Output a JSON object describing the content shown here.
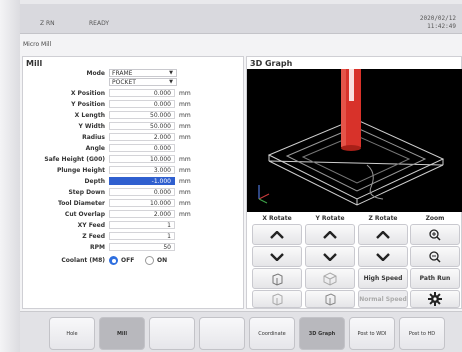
{
  "status": {
    "axis": "Z RN",
    "state": "READY",
    "date": "2020/02/12",
    "time": "11:42:49"
  },
  "breadcrumb": "Micro Mill",
  "mill": {
    "title": "Mill",
    "mode_label": "Mode",
    "mode_options": [
      "FRAME",
      "POCKET"
    ],
    "params": [
      {
        "label": "X Position",
        "value": "0.000",
        "unit": "mm"
      },
      {
        "label": "Y Position",
        "value": "0.000",
        "unit": "mm"
      },
      {
        "label": "X Length",
        "value": "50.000",
        "unit": "mm"
      },
      {
        "label": "Y Width",
        "value": "50.000",
        "unit": "mm"
      },
      {
        "label": "Radius",
        "value": "2.000",
        "unit": "mm"
      },
      {
        "label": "Angle",
        "value": "0.000",
        "unit": ""
      },
      {
        "label": "Safe Height (G00)",
        "value": "10.000",
        "unit": "mm"
      },
      {
        "label": "Plunge Height",
        "value": "3.000",
        "unit": "mm"
      },
      {
        "label": "Depth",
        "value": "-1.000",
        "unit": "mm"
      },
      {
        "label": "Step Down",
        "value": "0.000",
        "unit": "mm"
      },
      {
        "label": "Tool Diameter",
        "value": "10.000",
        "unit": "mm"
      },
      {
        "label": "Cut Overlap",
        "value": "2.000",
        "unit": "mm"
      },
      {
        "label": "XY Feed",
        "value": "1",
        "unit": ""
      },
      {
        "label": "Z Feed",
        "value": "1",
        "unit": ""
      },
      {
        "label": "RPM",
        "value": "50",
        "unit": ""
      }
    ],
    "coolant_label": "Coolant (M8)",
    "coolant_off": "OFF",
    "coolant_on": "ON"
  },
  "graph": {
    "title": "3D Graph",
    "headers": {
      "x_rotate": "X Rotate",
      "y_rotate": "Y Rotate",
      "z_rotate": "Z Rotate",
      "zoom": "Zoom"
    },
    "high_speed": "High Speed",
    "normal_speed": "Normal Speed",
    "path_run": "Path Run"
  },
  "tabs": [
    "Hole",
    "Mill",
    "",
    "",
    "Coordinate",
    "3D Graph",
    "Post to WDI",
    "Post to HD"
  ],
  "colors": {
    "accent": "#2f5fcf",
    "tool": "#d8322a",
    "active_tab": "#b8b8bd"
  }
}
